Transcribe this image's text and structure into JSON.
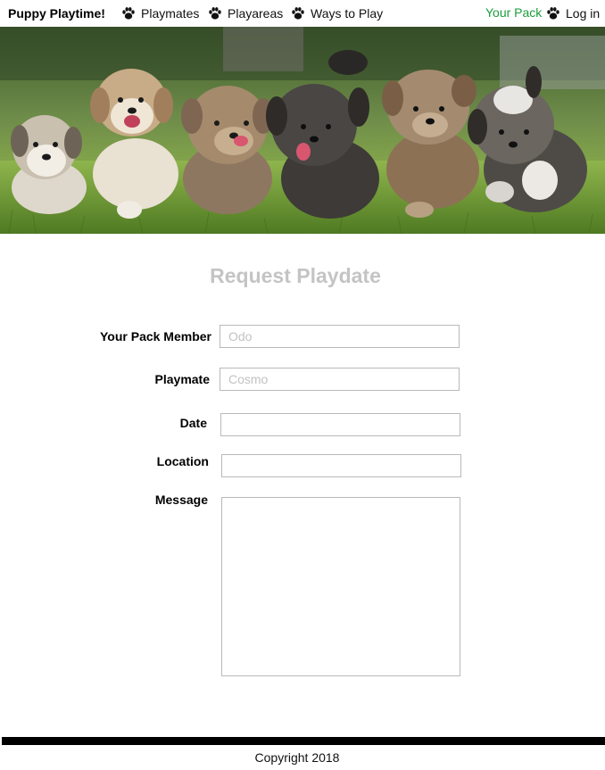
{
  "nav": {
    "brand": "Puppy Playtime!",
    "items": [
      {
        "label": "Playmates",
        "icon": "paw-icon"
      },
      {
        "label": "Playareas",
        "icon": "paw-icon"
      },
      {
        "label": "Ways to Play",
        "icon": "paw-icon"
      }
    ],
    "your_pack": "Your Pack",
    "login": {
      "label": "Log in",
      "icon": "paw-icon"
    }
  },
  "hero": {
    "subject": "puppies-running-on-grass"
  },
  "form": {
    "title": "Request Playdate",
    "fields": {
      "member": {
        "label": "Your Pack Member",
        "placeholder": "Odo"
      },
      "playmate": {
        "label": "Playmate",
        "placeholder": "Cosmo"
      },
      "date": {
        "label": "Date",
        "placeholder": ""
      },
      "location": {
        "label": "Location",
        "placeholder": ""
      },
      "message": {
        "label": "Message",
        "placeholder": ""
      }
    }
  },
  "footer": {
    "copyright": "Copyright 2018"
  },
  "colors": {
    "accent_green": "#1a9e3c",
    "title_gray": "#c4c4c4",
    "footer_bar": "#000000"
  }
}
